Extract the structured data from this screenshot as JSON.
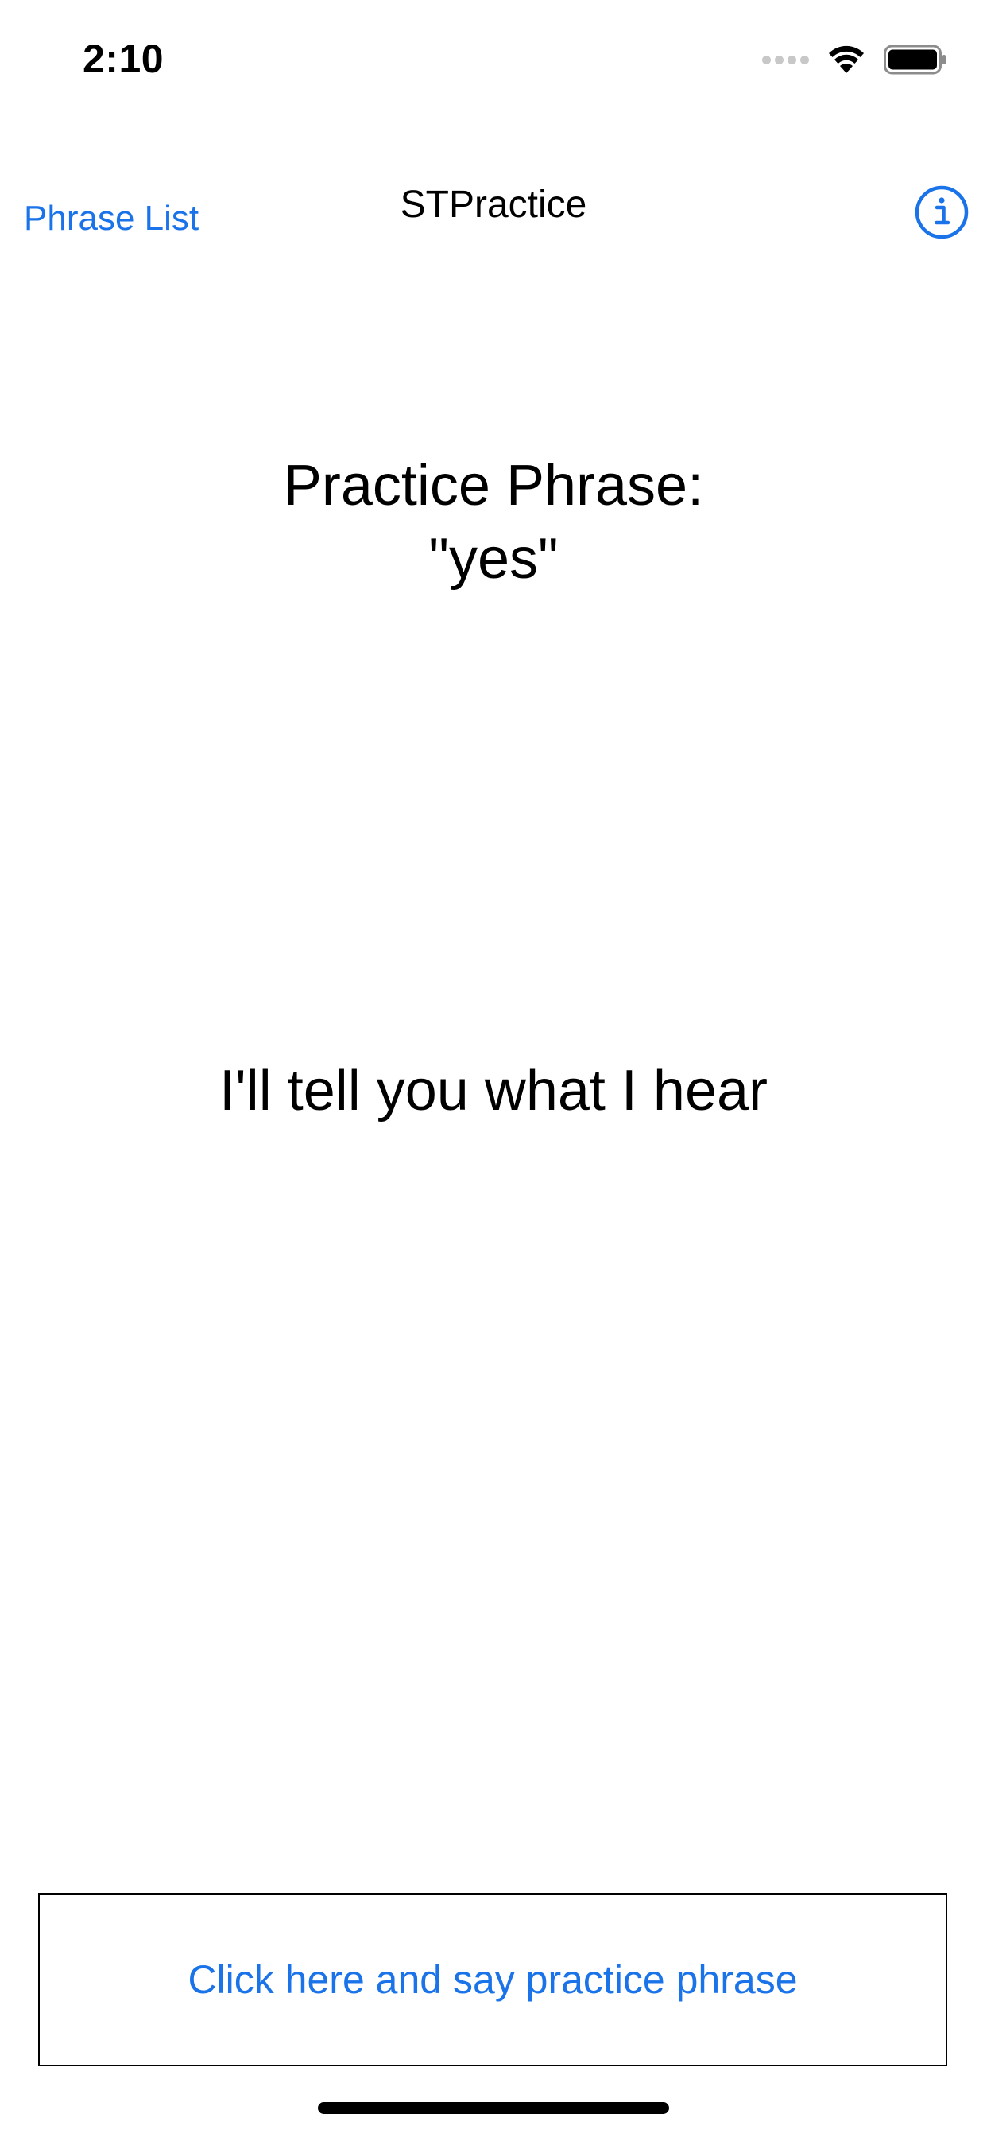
{
  "status_bar": {
    "time": "2:10"
  },
  "nav": {
    "back_label": "Phrase List",
    "title": "STPractice",
    "info_icon": "info-circle-icon"
  },
  "main": {
    "practice_label": "Practice Phrase:",
    "practice_phrase": "\"yes\"",
    "heard_text": "I'll tell you what I hear"
  },
  "actions": {
    "record_label": "Click here and say practice phrase"
  },
  "colors": {
    "accent": "#1a73e8",
    "text": "#000000",
    "background": "#ffffff"
  }
}
